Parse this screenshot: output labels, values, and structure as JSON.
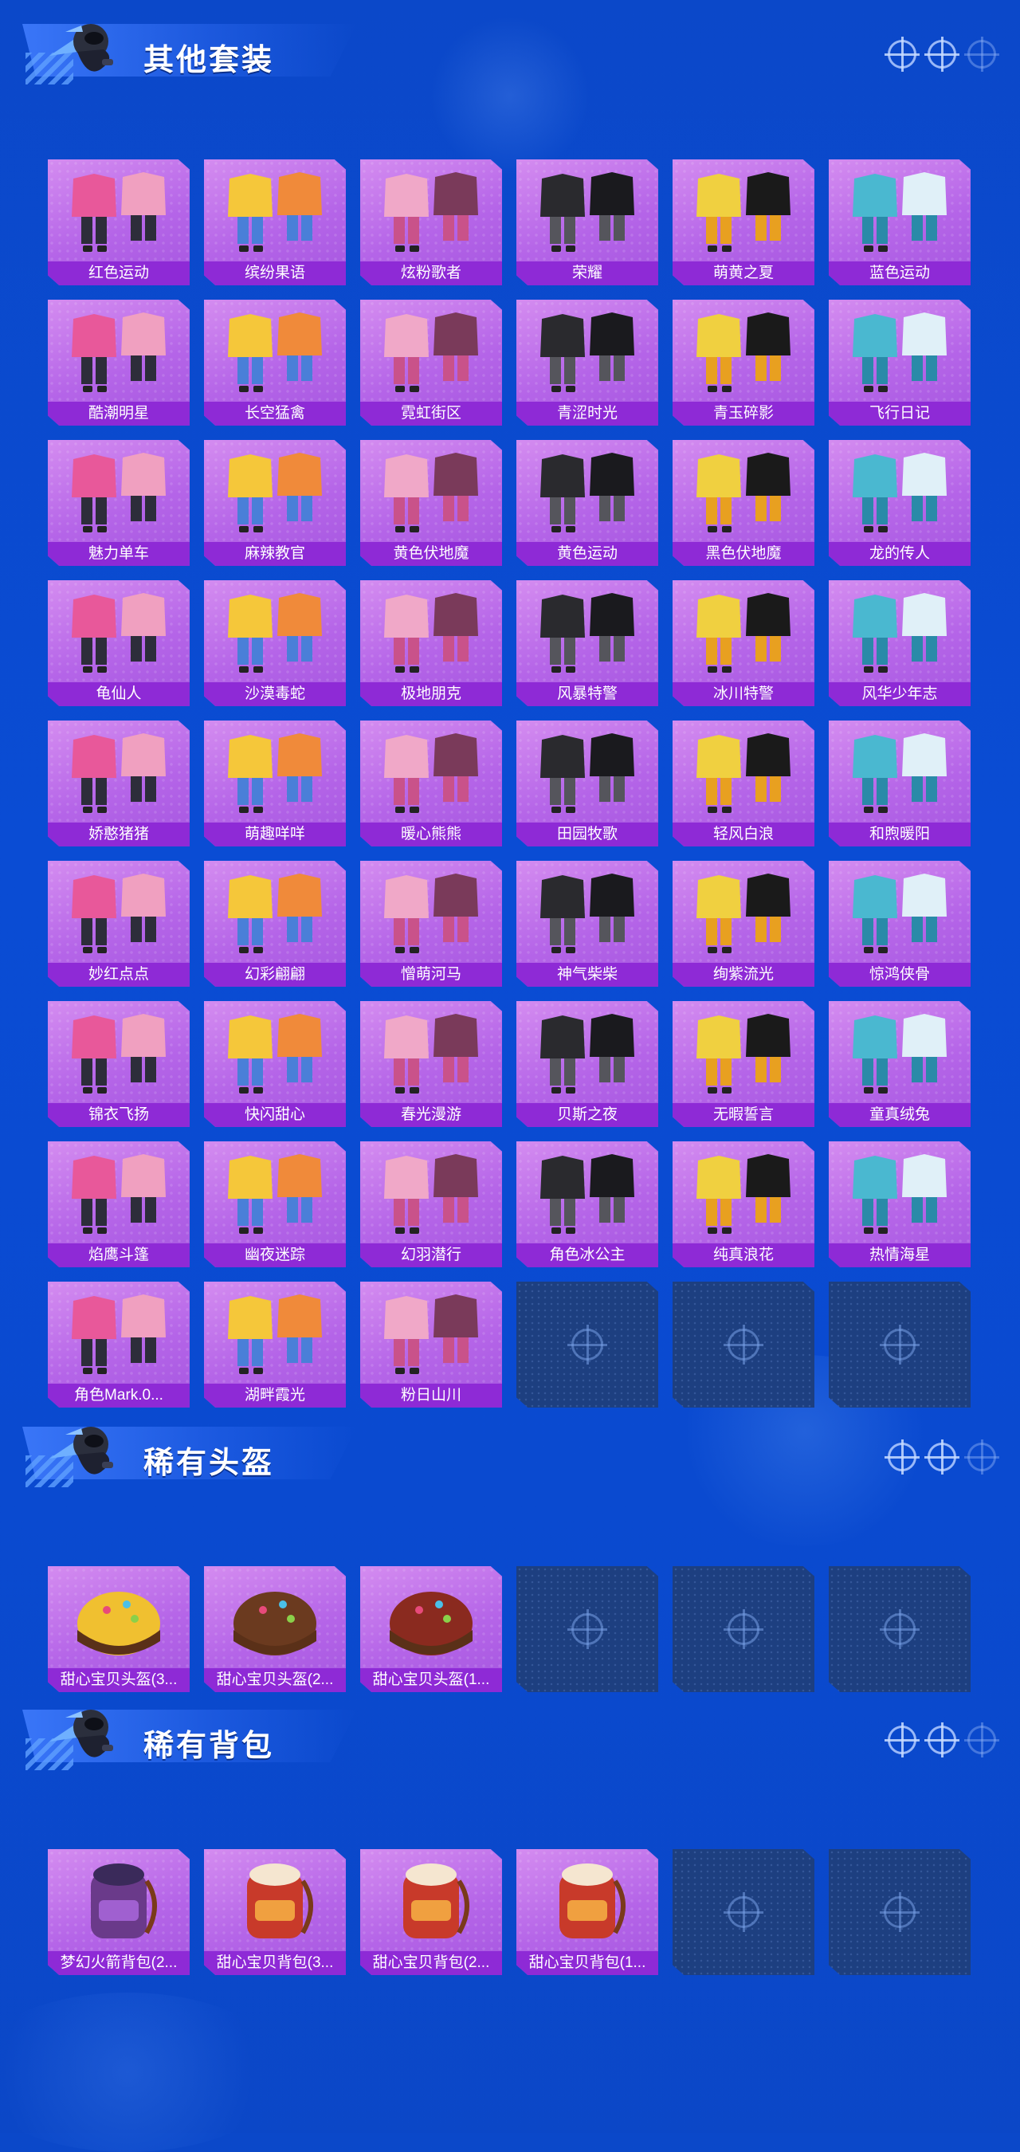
{
  "sections": [
    {
      "title": "其他套装",
      "items": [
        {
          "label": "红色运动",
          "icon": "outfit-icon"
        },
        {
          "label": "缤纷果语",
          "icon": "outfit-icon"
        },
        {
          "label": "炫粉歌者",
          "icon": "outfit-icon"
        },
        {
          "label": "荣耀",
          "icon": "outfit-icon"
        },
        {
          "label": "萌黄之夏",
          "icon": "outfit-icon"
        },
        {
          "label": "蓝色运动",
          "icon": "outfit-icon"
        },
        {
          "label": "酷潮明星",
          "icon": "outfit-icon"
        },
        {
          "label": "长空猛禽",
          "icon": "outfit-icon"
        },
        {
          "label": "霓虹街区",
          "icon": "outfit-icon"
        },
        {
          "label": "青涩时光",
          "icon": "outfit-icon"
        },
        {
          "label": "青玉碎影",
          "icon": "outfit-icon"
        },
        {
          "label": "飞行日记",
          "icon": "outfit-icon"
        },
        {
          "label": "魅力单车",
          "icon": "outfit-icon"
        },
        {
          "label": "麻辣教官",
          "icon": "outfit-icon"
        },
        {
          "label": "黄色伏地魔",
          "icon": "outfit-icon"
        },
        {
          "label": "黄色运动",
          "icon": "outfit-icon"
        },
        {
          "label": "黑色伏地魔",
          "icon": "outfit-icon"
        },
        {
          "label": "龙的传人",
          "icon": "outfit-icon"
        },
        {
          "label": "龟仙人",
          "icon": "outfit-icon"
        },
        {
          "label": "沙漠毒蛇",
          "icon": "outfit-icon"
        },
        {
          "label": "极地朋克",
          "icon": "outfit-icon"
        },
        {
          "label": "风暴特警",
          "icon": "outfit-icon"
        },
        {
          "label": "冰川特警",
          "icon": "outfit-icon"
        },
        {
          "label": "风华少年志",
          "icon": "outfit-icon"
        },
        {
          "label": "娇憨猪猪",
          "icon": "outfit-icon"
        },
        {
          "label": "萌趣咩咩",
          "icon": "outfit-icon"
        },
        {
          "label": "暖心熊熊",
          "icon": "outfit-icon"
        },
        {
          "label": "田园牧歌",
          "icon": "outfit-icon"
        },
        {
          "label": "轻风白浪",
          "icon": "outfit-icon"
        },
        {
          "label": "和煦暖阳",
          "icon": "outfit-icon"
        },
        {
          "label": "妙红点点",
          "icon": "outfit-icon"
        },
        {
          "label": "幻彩翩翩",
          "icon": "outfit-icon"
        },
        {
          "label": "憎萌河马",
          "icon": "outfit-icon"
        },
        {
          "label": "神气柴柴",
          "icon": "outfit-icon"
        },
        {
          "label": "绚紫流光",
          "icon": "outfit-icon"
        },
        {
          "label": "惊鸿侠骨",
          "icon": "outfit-icon"
        },
        {
          "label": "锦衣飞扬",
          "icon": "outfit-icon"
        },
        {
          "label": "快闪甜心",
          "icon": "outfit-icon"
        },
        {
          "label": "春光漫游",
          "icon": "outfit-icon"
        },
        {
          "label": "贝斯之夜",
          "icon": "outfit-icon"
        },
        {
          "label": "无暇誓言",
          "icon": "outfit-icon"
        },
        {
          "label": "童真绒兔",
          "icon": "outfit-icon"
        },
        {
          "label": "焰鹰斗篷",
          "icon": "outfit-icon"
        },
        {
          "label": "幽夜迷踪",
          "icon": "outfit-icon"
        },
        {
          "label": "幻羽潜行",
          "icon": "outfit-icon"
        },
        {
          "label": "角色冰公主",
          "icon": "outfit-icon"
        },
        {
          "label": "纯真浪花",
          "icon": "outfit-icon"
        },
        {
          "label": "热情海星",
          "icon": "outfit-icon"
        },
        {
          "label": "角色Mark.0...",
          "icon": "outfit-icon"
        },
        {
          "label": "湖畔霞光",
          "icon": "outfit-icon"
        },
        {
          "label": "粉日山川",
          "icon": "outfit-icon"
        }
      ],
      "empty_slots": 3
    },
    {
      "title": "稀有头盔",
      "items": [
        {
          "label": "甜心宝贝头盔(3...",
          "icon": "helmet-icon"
        },
        {
          "label": "甜心宝贝头盔(2...",
          "icon": "helmet-icon"
        },
        {
          "label": "甜心宝贝头盔(1...",
          "icon": "helmet-icon"
        }
      ],
      "empty_slots": 3
    },
    {
      "title": "稀有背包",
      "items": [
        {
          "label": "梦幻火箭背包(2...",
          "icon": "backpack-icon"
        },
        {
          "label": "甜心宝贝背包(3...",
          "icon": "backpack-icon"
        },
        {
          "label": "甜心宝贝背包(2...",
          "icon": "backpack-icon"
        },
        {
          "label": "甜心宝贝背包(1...",
          "icon": "backpack-icon"
        }
      ],
      "empty_slots": 2
    }
  ],
  "colors": {
    "background": "#0a4cd4",
    "card": "#b565e8",
    "label_bar": "#8e2ad6",
    "empty_slot": "#1d3f80"
  }
}
